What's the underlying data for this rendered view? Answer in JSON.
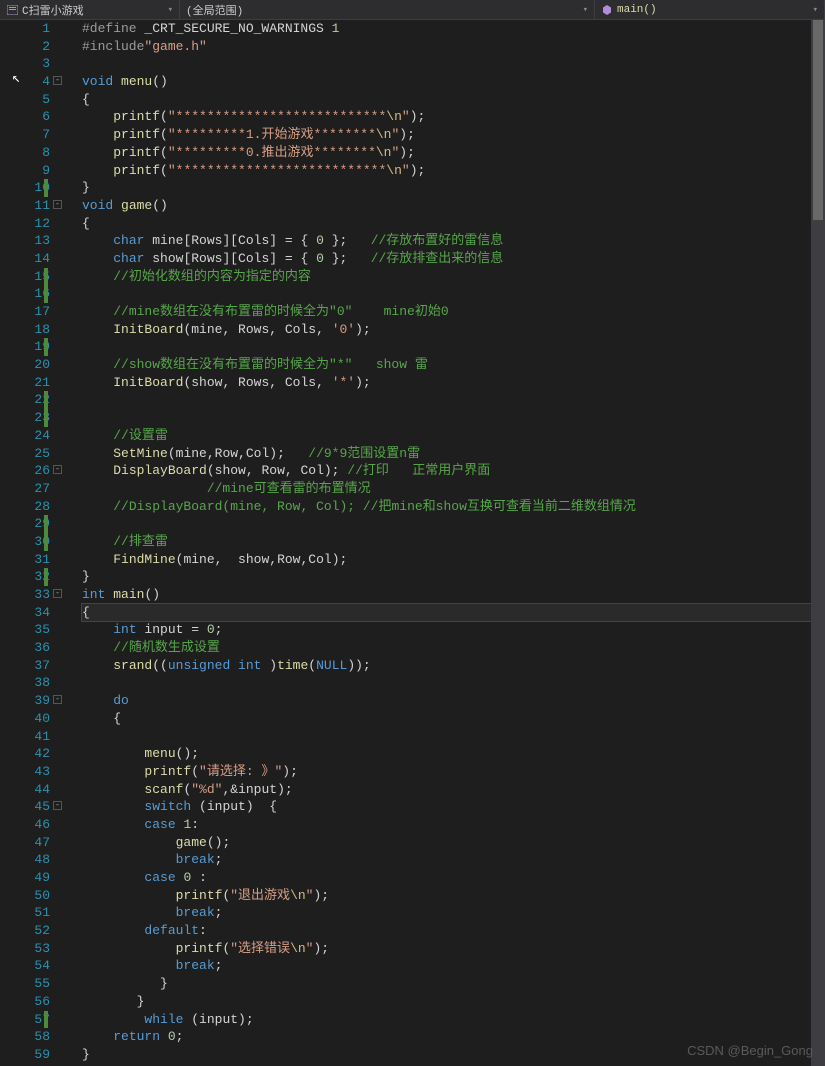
{
  "toolbar": {
    "file_label": "C扫雷小游戏",
    "scope_label": "(全局范围)",
    "function_label": "main()"
  },
  "watermark": "CSDN @Begin_Gong",
  "line_count": 59,
  "changed_lines": [
    10,
    15,
    16,
    19,
    22,
    23,
    29,
    30,
    32,
    57
  ],
  "folds": {
    "4": "-",
    "11": "-",
    "26": "-",
    "33": "-",
    "39": "-",
    "45": "-"
  },
  "code_lines": [
    [
      [
        "macro",
        "#define"
      ],
      [
        "ident",
        " _CRT_SECURE_NO_WARNINGS "
      ],
      [
        "num",
        "1"
      ]
    ],
    [
      [
        "macro",
        "#include"
      ],
      [
        "str",
        "\"game.h\""
      ]
    ],
    [],
    [
      [
        "kw",
        "void"
      ],
      [
        "ident",
        " "
      ],
      [
        "func",
        "menu"
      ],
      [
        "punct",
        "()"
      ]
    ],
    [
      [
        "punct",
        "{"
      ]
    ],
    [
      [
        "ident",
        "    "
      ],
      [
        "func",
        "printf"
      ],
      [
        "punct",
        "("
      ],
      [
        "str",
        "\"***************************"
      ],
      [
        "esc",
        "\\n"
      ],
      [
        "str",
        "\""
      ],
      [
        "punct",
        ");"
      ]
    ],
    [
      [
        "ident",
        "    "
      ],
      [
        "func",
        "printf"
      ],
      [
        "punct",
        "("
      ],
      [
        "str",
        "\"*********1.开始游戏********"
      ],
      [
        "esc",
        "\\n"
      ],
      [
        "str",
        "\""
      ],
      [
        "punct",
        ");"
      ]
    ],
    [
      [
        "ident",
        "    "
      ],
      [
        "func",
        "printf"
      ],
      [
        "punct",
        "("
      ],
      [
        "str",
        "\"*********0.推出游戏********"
      ],
      [
        "esc",
        "\\n"
      ],
      [
        "str",
        "\""
      ],
      [
        "punct",
        ");"
      ]
    ],
    [
      [
        "ident",
        "    "
      ],
      [
        "func",
        "printf"
      ],
      [
        "punct",
        "("
      ],
      [
        "str",
        "\"***************************"
      ],
      [
        "esc",
        "\\n"
      ],
      [
        "str",
        "\""
      ],
      [
        "punct",
        ");"
      ]
    ],
    [
      [
        "punct",
        "}"
      ]
    ],
    [
      [
        "kw",
        "void"
      ],
      [
        "ident",
        " "
      ],
      [
        "func",
        "game"
      ],
      [
        "punct",
        "()"
      ]
    ],
    [
      [
        "punct",
        "{"
      ]
    ],
    [
      [
        "ident",
        "    "
      ],
      [
        "kw",
        "char"
      ],
      [
        "ident",
        " mine[Rows][Cols] = { "
      ],
      [
        "num",
        "0"
      ],
      [
        "ident",
        " };   "
      ],
      [
        "comment",
        "//存放布置好的雷信息"
      ]
    ],
    [
      [
        "ident",
        "    "
      ],
      [
        "kw",
        "char"
      ],
      [
        "ident",
        " show[Rows][Cols] = { "
      ],
      [
        "num",
        "0"
      ],
      [
        "ident",
        " };   "
      ],
      [
        "comment",
        "//存放排查出来的信息"
      ]
    ],
    [
      [
        "ident",
        "    "
      ],
      [
        "comment",
        "//初始化数组的内容为指定的内容"
      ]
    ],
    [],
    [
      [
        "ident",
        "    "
      ],
      [
        "comment",
        "//mine数组在没有布置雷的时候全为\"0\"    mine初始0"
      ]
    ],
    [
      [
        "ident",
        "    "
      ],
      [
        "func",
        "InitBoard"
      ],
      [
        "punct",
        "("
      ],
      [
        "ident",
        "mine, Rows, Cols, "
      ],
      [
        "str",
        "'0'"
      ],
      [
        "punct",
        ");"
      ]
    ],
    [],
    [
      [
        "ident",
        "    "
      ],
      [
        "comment",
        "//show数组在没有布置雷的时候全为\"*\"   show 雷"
      ]
    ],
    [
      [
        "ident",
        "    "
      ],
      [
        "func",
        "InitBoard"
      ],
      [
        "punct",
        "("
      ],
      [
        "ident",
        "show, Rows, Cols, "
      ],
      [
        "str",
        "'*'"
      ],
      [
        "punct",
        ");"
      ]
    ],
    [],
    [],
    [
      [
        "ident",
        "    "
      ],
      [
        "comment",
        "//设置雷"
      ]
    ],
    [
      [
        "ident",
        "    "
      ],
      [
        "func",
        "SetMine"
      ],
      [
        "punct",
        "("
      ],
      [
        "ident",
        "mine,Row,Col"
      ],
      [
        "punct",
        ");   "
      ],
      [
        "comment",
        "//9*9范围设置n雷"
      ]
    ],
    [
      [
        "ident",
        "    "
      ],
      [
        "func",
        "DisplayBoard"
      ],
      [
        "punct",
        "("
      ],
      [
        "ident",
        "show, Row, Col"
      ],
      [
        "punct",
        "); "
      ],
      [
        "comment",
        "//打印   正常用户界面"
      ]
    ],
    [
      [
        "ident",
        "                "
      ],
      [
        "comment",
        "//mine可查看雷的布置情况"
      ]
    ],
    [
      [
        "ident",
        "    "
      ],
      [
        "comment",
        "//DisplayBoard(mine, Row, Col); //把mine和show互换可查看当前二维数组情况"
      ]
    ],
    [],
    [
      [
        "ident",
        "    "
      ],
      [
        "comment",
        "//排查雷"
      ]
    ],
    [
      [
        "ident",
        "    "
      ],
      [
        "func",
        "FindMine"
      ],
      [
        "punct",
        "("
      ],
      [
        "ident",
        "mine,  show,Row,Col"
      ],
      [
        "punct",
        ");"
      ]
    ],
    [
      [
        "punct",
        "}"
      ]
    ],
    [
      [
        "kw",
        "int"
      ],
      [
        "ident",
        " "
      ],
      [
        "func",
        "main"
      ],
      [
        "punct",
        "()"
      ]
    ],
    [
      [
        "punct",
        "{"
      ]
    ],
    [
      [
        "ident",
        "    "
      ],
      [
        "kw",
        "int"
      ],
      [
        "ident",
        " input = "
      ],
      [
        "num",
        "0"
      ],
      [
        "punct",
        ";"
      ]
    ],
    [
      [
        "ident",
        "    "
      ],
      [
        "comment",
        "//随机数生成设置"
      ]
    ],
    [
      [
        "ident",
        "    "
      ],
      [
        "func",
        "srand"
      ],
      [
        "punct",
        "(("
      ],
      [
        "kw",
        "unsigned int"
      ],
      [
        "ident",
        " )"
      ],
      [
        "func",
        "time"
      ],
      [
        "punct",
        "("
      ],
      [
        "kw",
        "NULL"
      ],
      [
        "punct",
        "));"
      ]
    ],
    [],
    [
      [
        "ident",
        "    "
      ],
      [
        "kw",
        "do"
      ]
    ],
    [
      [
        "ident",
        "    "
      ],
      [
        "punct",
        "{"
      ]
    ],
    [],
    [
      [
        "ident",
        "        "
      ],
      [
        "func",
        "menu"
      ],
      [
        "punct",
        "();"
      ]
    ],
    [
      [
        "ident",
        "        "
      ],
      [
        "func",
        "printf"
      ],
      [
        "punct",
        "("
      ],
      [
        "str",
        "\"请选择: 》\""
      ],
      [
        "punct",
        ");"
      ]
    ],
    [
      [
        "ident",
        "        "
      ],
      [
        "func",
        "scanf"
      ],
      [
        "punct",
        "("
      ],
      [
        "str",
        "\"%d\""
      ],
      [
        "punct",
        ",&input);"
      ]
    ],
    [
      [
        "ident",
        "        "
      ],
      [
        "kw",
        "switch"
      ],
      [
        "ident",
        " (input)  "
      ],
      [
        "punct",
        "{"
      ]
    ],
    [
      [
        "ident",
        "        "
      ],
      [
        "kw",
        "case"
      ],
      [
        "ident",
        " "
      ],
      [
        "num",
        "1"
      ],
      [
        "punct",
        ":"
      ]
    ],
    [
      [
        "ident",
        "            "
      ],
      [
        "func",
        "game"
      ],
      [
        "punct",
        "();"
      ]
    ],
    [
      [
        "ident",
        "            "
      ],
      [
        "kw",
        "break"
      ],
      [
        "punct",
        ";"
      ]
    ],
    [
      [
        "ident",
        "        "
      ],
      [
        "kw",
        "case"
      ],
      [
        "ident",
        " "
      ],
      [
        "num",
        "0"
      ],
      [
        "ident",
        " "
      ],
      [
        "punct",
        ":"
      ]
    ],
    [
      [
        "ident",
        "            "
      ],
      [
        "func",
        "printf"
      ],
      [
        "punct",
        "("
      ],
      [
        "str",
        "\"退出游戏"
      ],
      [
        "esc",
        "\\n"
      ],
      [
        "str",
        "\""
      ],
      [
        "punct",
        ");"
      ]
    ],
    [
      [
        "ident",
        "            "
      ],
      [
        "kw",
        "break"
      ],
      [
        "punct",
        ";"
      ]
    ],
    [
      [
        "ident",
        "        "
      ],
      [
        "kw",
        "default"
      ],
      [
        "punct",
        ":"
      ]
    ],
    [
      [
        "ident",
        "            "
      ],
      [
        "func",
        "printf"
      ],
      [
        "punct",
        "("
      ],
      [
        "str",
        "\"选择错误"
      ],
      [
        "esc",
        "\\n"
      ],
      [
        "str",
        "\""
      ],
      [
        "punct",
        ");"
      ]
    ],
    [
      [
        "ident",
        "            "
      ],
      [
        "kw",
        "break"
      ],
      [
        "punct",
        ";"
      ]
    ],
    [
      [
        "ident",
        "          "
      ],
      [
        "punct",
        "}"
      ]
    ],
    [
      [
        "ident",
        "       "
      ],
      [
        "punct",
        "}"
      ]
    ],
    [
      [
        "ident",
        "        "
      ],
      [
        "kw",
        "while"
      ],
      [
        "ident",
        " (input)"
      ],
      [
        "punct",
        ";"
      ]
    ],
    [
      [
        "ident",
        "    "
      ],
      [
        "kw",
        "return"
      ],
      [
        "ident",
        " "
      ],
      [
        "num",
        "0"
      ],
      [
        "punct",
        ";"
      ]
    ],
    [
      [
        "punct",
        "}"
      ]
    ]
  ],
  "highlighted_line": 34
}
